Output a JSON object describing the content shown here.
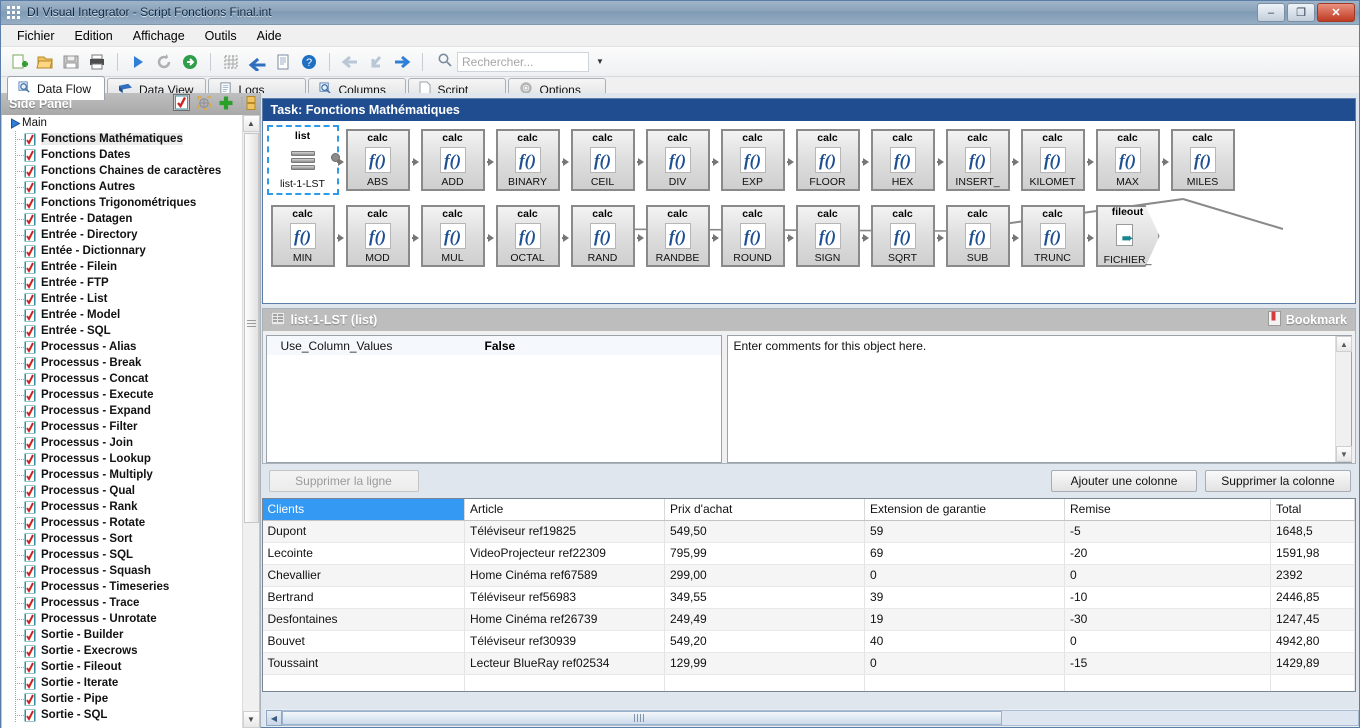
{
  "window": {
    "title": "DI Visual Integrator - Script Fonctions Final.int",
    "minimize_label": "–",
    "maximize_label": "❐",
    "close_label": "✕"
  },
  "menu": [
    {
      "label": "Fichier"
    },
    {
      "label": "Edition"
    },
    {
      "label": "Affichage"
    },
    {
      "label": "Outils"
    },
    {
      "label": "Aide"
    }
  ],
  "toolbar": {
    "buttons": [
      {
        "name": "new-icon"
      },
      {
        "name": "open-icon"
      },
      {
        "name": "save-icon"
      },
      {
        "name": "print-icon"
      },
      {
        "name": "run-icon"
      },
      {
        "name": "refresh-icon"
      },
      {
        "name": "step-icon"
      },
      {
        "name": "grid-icon"
      },
      {
        "name": "undo-icon"
      },
      {
        "name": "document-icon"
      },
      {
        "name": "help-icon"
      },
      {
        "name": "back-icon"
      },
      {
        "name": "down-left-icon"
      },
      {
        "name": "forward-icon"
      }
    ],
    "search_placeholder": "Rechercher...",
    "search_value": "",
    "search_dropdown": "▼"
  },
  "tabs": [
    {
      "label": "Data Flow",
      "icon": "magnifier-icon",
      "active": true
    },
    {
      "label": "Data View",
      "icon": "table-icon",
      "active": false
    },
    {
      "label": "Logs",
      "icon": "log-icon",
      "active": false
    },
    {
      "label": "Columns",
      "icon": "columns-icon",
      "active": false
    },
    {
      "label": "Script",
      "icon": "page-icon",
      "active": false
    },
    {
      "label": "Options",
      "icon": "gear-icon",
      "active": false
    }
  ],
  "sidebar": {
    "title": "Side Panel",
    "tools": [
      {
        "name": "checklist-icon"
      },
      {
        "name": "globe-icon"
      },
      {
        "name": "add-plus-icon"
      },
      {
        "name": "organize-icon"
      }
    ],
    "root": "Main",
    "items": [
      {
        "label": "Fonctions Mathématiques",
        "selected": true
      },
      {
        "label": "Fonctions Dates",
        "selected": false
      },
      {
        "label": "Fonctions Chaines de caractères",
        "selected": false
      },
      {
        "label": "Fonctions Autres",
        "selected": false
      },
      {
        "label": "Fonctions Trigonométriques",
        "selected": false
      },
      {
        "label": "Entrée - Datagen",
        "selected": false
      },
      {
        "label": "Entrée - Directory",
        "selected": false
      },
      {
        "label": "Entée - Dictionnary",
        "selected": false
      },
      {
        "label": "Entrée - Filein",
        "selected": false
      },
      {
        "label": "Entrée - FTP",
        "selected": false
      },
      {
        "label": "Entrée - List",
        "selected": false
      },
      {
        "label": "Entrée - Model",
        "selected": false
      },
      {
        "label": "Entrée - SQL",
        "selected": false
      },
      {
        "label": "Processus - Alias",
        "selected": false
      },
      {
        "label": "Processus - Break",
        "selected": false
      },
      {
        "label": "Processus - Concat",
        "selected": false
      },
      {
        "label": "Processus - Execute",
        "selected": false
      },
      {
        "label": "Processus - Expand",
        "selected": false
      },
      {
        "label": "Processus - Filter",
        "selected": false
      },
      {
        "label": "Processus - Join",
        "selected": false
      },
      {
        "label": "Processus - Lookup",
        "selected": false
      },
      {
        "label": "Processus - Multiply",
        "selected": false
      },
      {
        "label": "Processus - Qual",
        "selected": false
      },
      {
        "label": "Processus - Rank",
        "selected": false
      },
      {
        "label": "Processus - Rotate",
        "selected": false
      },
      {
        "label": "Processus - Sort",
        "selected": false
      },
      {
        "label": "Processus - SQL",
        "selected": false
      },
      {
        "label": "Processus - Squash",
        "selected": false
      },
      {
        "label": "Processus - Timeseries",
        "selected": false
      },
      {
        "label": "Processus - Trace",
        "selected": false
      },
      {
        "label": "Processus - Unrotate",
        "selected": false
      },
      {
        "label": "Sortie - Builder",
        "selected": false
      },
      {
        "label": "Sortie - Execrows",
        "selected": false
      },
      {
        "label": "Sortie - Fileout",
        "selected": false
      },
      {
        "label": "Sortie - Iterate",
        "selected": false
      },
      {
        "label": "Sortie - Pipe",
        "selected": false
      },
      {
        "label": "Sortie - SQL",
        "selected": false
      }
    ]
  },
  "flow": {
    "header": "Task: Fonctions Mathématiques",
    "row1": [
      {
        "type": "list",
        "name": "list-1-LST",
        "shape": "list",
        "selected": true
      },
      {
        "type": "calc",
        "name": "ABS",
        "shape": "calc"
      },
      {
        "type": "calc",
        "name": "ADD",
        "shape": "calc"
      },
      {
        "type": "calc",
        "name": "BINARY",
        "shape": "calc"
      },
      {
        "type": "calc",
        "name": "CEIL",
        "shape": "calc"
      },
      {
        "type": "calc",
        "name": "DIV",
        "shape": "calc"
      },
      {
        "type": "calc",
        "name": "EXP",
        "shape": "calc"
      },
      {
        "type": "calc",
        "name": "FLOOR",
        "shape": "calc"
      },
      {
        "type": "calc",
        "name": "HEX",
        "shape": "calc"
      },
      {
        "type": "calc",
        "name": "INSERT_",
        "shape": "calc"
      },
      {
        "type": "calc",
        "name": "KILOMET",
        "shape": "calc"
      },
      {
        "type": "calc",
        "name": "MAX",
        "shape": "calc"
      },
      {
        "type": "calc",
        "name": "MILES",
        "shape": "calc"
      }
    ],
    "row2": [
      {
        "type": "calc",
        "name": "MIN",
        "shape": "calc"
      },
      {
        "type": "calc",
        "name": "MOD",
        "shape": "calc"
      },
      {
        "type": "calc",
        "name": "MUL",
        "shape": "calc"
      },
      {
        "type": "calc",
        "name": "OCTAL",
        "shape": "calc"
      },
      {
        "type": "calc",
        "name": "RAND",
        "shape": "calc"
      },
      {
        "type": "calc",
        "name": "RANDBE",
        "shape": "calc"
      },
      {
        "type": "calc",
        "name": "ROUND",
        "shape": "calc"
      },
      {
        "type": "calc",
        "name": "SIGN",
        "shape": "calc"
      },
      {
        "type": "calc",
        "name": "SQRT",
        "shape": "calc"
      },
      {
        "type": "calc",
        "name": "SUB",
        "shape": "calc"
      },
      {
        "type": "calc",
        "name": "TRUNC",
        "shape": "calc"
      },
      {
        "type": "fileout",
        "name": "FICHIER_",
        "shape": "fileout"
      }
    ]
  },
  "properties": {
    "header": "list-1-LST (list)",
    "bookmark_label": "Bookmark",
    "rows": [
      {
        "key": "Use_Column_Values",
        "value": "False"
      }
    ],
    "comment_placeholder": "Enter comments for this object here."
  },
  "actions": {
    "delete_row": "Supprimer la ligne",
    "add_column": "Ajouter une colonne",
    "delete_column": "Supprimer la colonne"
  },
  "grid": {
    "columns": [
      "Clients",
      "Article",
      "Prix d'achat",
      "Extension de garantie",
      "Remise",
      "Total"
    ],
    "selected_column": "Clients",
    "rows": [
      [
        "Dupont",
        "Téléviseur ref19825",
        "549,50",
        "59",
        "-5",
        "1648,5"
      ],
      [
        "Lecointe",
        "VideoProjecteur ref22309",
        "795,99",
        "69",
        "-20",
        "1591,98"
      ],
      [
        "Chevallier",
        "Home Cinéma ref67589",
        "299,00",
        "0",
        "0",
        "2392"
      ],
      [
        "Bertrand",
        "Téléviseur ref56983",
        "349,55",
        "39",
        "-10",
        "2446,85"
      ],
      [
        "Desfontaines",
        "Home Cinéma ref26739",
        "249,49",
        "19",
        "-30",
        "1247,45"
      ],
      [
        "Bouvet",
        "Téléviseur ref30939",
        "549,20",
        "40",
        "0",
        "4942,80"
      ],
      [
        "Toussaint",
        "Lecteur BlueRay ref02534",
        "129,99",
        "0",
        "-15",
        "1429,89"
      ],
      [
        "",
        "",
        "",
        "",
        "",
        ""
      ]
    ]
  },
  "colors": {
    "accent_blue": "#1f4d8f",
    "selection_blue": "#3399f3",
    "fx_blue": "#1d4f91",
    "dashed_select": "#2e9bea"
  }
}
